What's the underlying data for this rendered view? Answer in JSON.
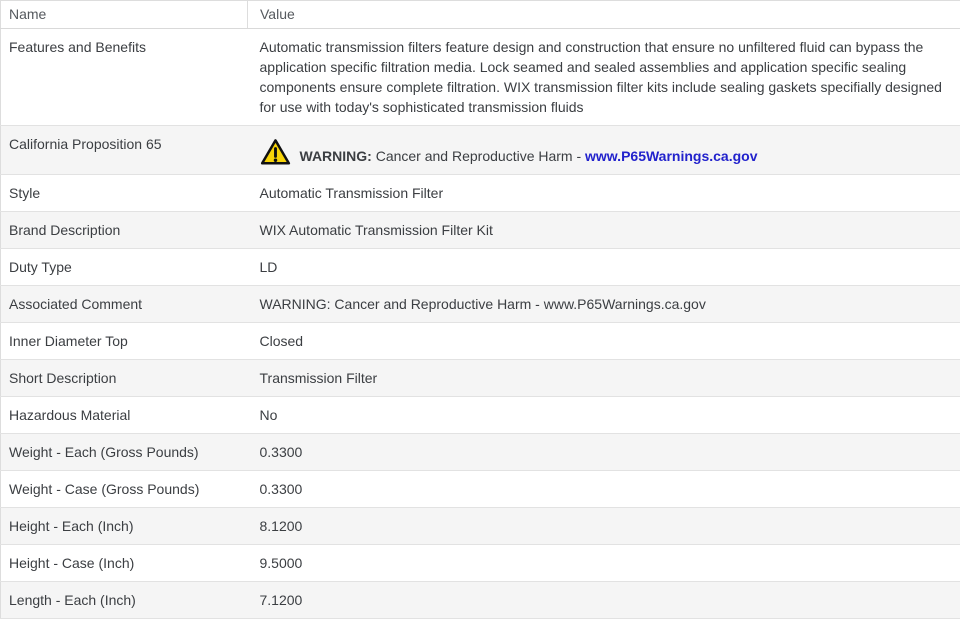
{
  "header": {
    "name_col": "Name",
    "value_col": "Value"
  },
  "rows": [
    {
      "name": "Features and Benefits",
      "value": "Automatic transmission filters feature design and construction that ensure no unfiltered fluid can bypass the application specific filtration media. Lock seamed and sealed assemblies and application specific sealing components ensure complete filtration. WIX transmission filter kits include sealing gaskets specifially designed for use with today's sophisticated transmission fluids"
    },
    {
      "name": "California Proposition 65",
      "warning_icon": "warning-triangle-icon",
      "warning_bold": "WARNING:",
      "warning_text": " Cancer and Reproductive Harm - ",
      "warning_link": "www.P65Warnings.ca.gov"
    },
    {
      "name": "Style",
      "value": "Automatic Transmission Filter"
    },
    {
      "name": "Brand Description",
      "value": "WIX Automatic Transmission Filter Kit"
    },
    {
      "name": "Duty Type",
      "value": "LD"
    },
    {
      "name": "Associated Comment",
      "value": "WARNING: Cancer and Reproductive Harm - www.P65Warnings.ca.gov"
    },
    {
      "name": "Inner Diameter Top",
      "value": "Closed"
    },
    {
      "name": "Short Description",
      "value": "Transmission Filter"
    },
    {
      "name": "Hazardous Material",
      "value": "No"
    },
    {
      "name": "Weight - Each (Gross Pounds)",
      "value": "0.3300"
    },
    {
      "name": "Weight - Case (Gross Pounds)",
      "value": "0.3300"
    },
    {
      "name": "Height - Each (Inch)",
      "value": "8.1200"
    },
    {
      "name": "Height - Case (Inch)",
      "value": "9.5000"
    },
    {
      "name": "Length - Each (Inch)",
      "value": "7.1200"
    }
  ],
  "colors": {
    "link_blue": "#2222cc",
    "warning_yellow": "#f8d408",
    "warning_outline": "#111111",
    "row_stripe": "#f5f5f5",
    "border": "#dddddd",
    "body_text": "#3b3e42",
    "header_text": "#55595e"
  }
}
